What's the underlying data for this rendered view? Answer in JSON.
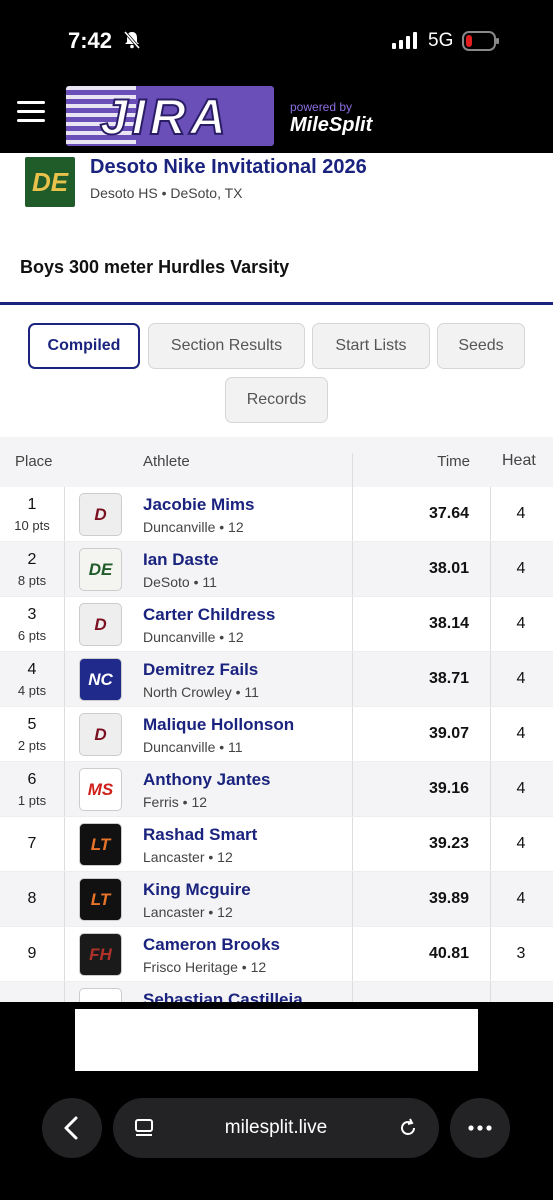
{
  "status_bar": {
    "time": "7:42",
    "network": "5G"
  },
  "header": {
    "logo_text": "JIRA",
    "powered_by": "powered by",
    "brand": "MileSplit"
  },
  "meet": {
    "logo_text": "DE",
    "title": "Desoto Nike Invitational 2026",
    "location": "Desoto HS • DeSoto, TX"
  },
  "event": {
    "title": "Boys 300 meter Hurdles Varsity"
  },
  "tabs": [
    {
      "label": "Compiled"
    },
    {
      "label": "Section Results"
    },
    {
      "label": "Start Lists"
    },
    {
      "label": "Seeds"
    },
    {
      "label": "Records"
    }
  ],
  "table": {
    "headers": {
      "place": "Place",
      "athlete": "Athlete",
      "time": "Time",
      "heat": "Heat"
    },
    "rows": [
      {
        "place": "1",
        "pts": "10 pts",
        "logo": "D",
        "logo_bg": "#eeeeee",
        "logo_fg": "#7a1020",
        "name": "Jacobie Mims",
        "team": "Duncanville • 12",
        "time": "37.64",
        "heat": "4"
      },
      {
        "place": "2",
        "pts": "8 pts",
        "logo": "DE",
        "logo_bg": "#f4f4f0",
        "logo_fg": "#1f5c2a",
        "name": "Ian Daste",
        "team": "DeSoto • 11",
        "time": "38.01",
        "heat": "4"
      },
      {
        "place": "3",
        "pts": "6 pts",
        "logo": "D",
        "logo_bg": "#eeeeee",
        "logo_fg": "#7a1020",
        "name": "Carter Childress",
        "team": "Duncanville • 12",
        "time": "38.14",
        "heat": "4"
      },
      {
        "place": "4",
        "pts": "4 pts",
        "logo": "NC",
        "logo_bg": "#1f2a8a",
        "logo_fg": "#ffffff",
        "name": "Demitrez Fails",
        "team": "North Crowley • 11",
        "time": "38.71",
        "heat": "4"
      },
      {
        "place": "5",
        "pts": "2 pts",
        "logo": "D",
        "logo_bg": "#eeeeee",
        "logo_fg": "#7a1020",
        "name": "Malique Hollonson",
        "team": "Duncanville • 11",
        "time": "39.07",
        "heat": "4"
      },
      {
        "place": "6",
        "pts": "1 pts",
        "logo": "MS",
        "logo_bg": "#ffffff",
        "logo_fg": "#d0201c",
        "name": "Anthony Jantes",
        "team": "Ferris • 12",
        "time": "39.16",
        "heat": "4"
      },
      {
        "place": "7",
        "pts": "",
        "logo": "LT",
        "logo_bg": "#111111",
        "logo_fg": "#e8742a",
        "name": "Rashad Smart",
        "team": "Lancaster • 12",
        "time": "39.23",
        "heat": "4"
      },
      {
        "place": "8",
        "pts": "",
        "logo": "LT",
        "logo_bg": "#111111",
        "logo_fg": "#e8742a",
        "name": "King Mcguire",
        "team": "Lancaster • 12",
        "time": "39.89",
        "heat": "4"
      },
      {
        "place": "9",
        "pts": "",
        "logo": "FH",
        "logo_bg": "#1a1a1a",
        "logo_fg": "#b0302a",
        "name": "Cameron Brooks",
        "team": "Frisco Heritage • 12",
        "time": "40.81",
        "heat": "3"
      },
      {
        "place": "",
        "pts": "",
        "logo": "H",
        "logo_bg": "#ffffff",
        "logo_fg": "#8a1020",
        "name": "Sebastian Castilleja",
        "team": "",
        "time": "",
        "heat": ""
      }
    ]
  },
  "browser": {
    "url": "milesplit.live"
  }
}
